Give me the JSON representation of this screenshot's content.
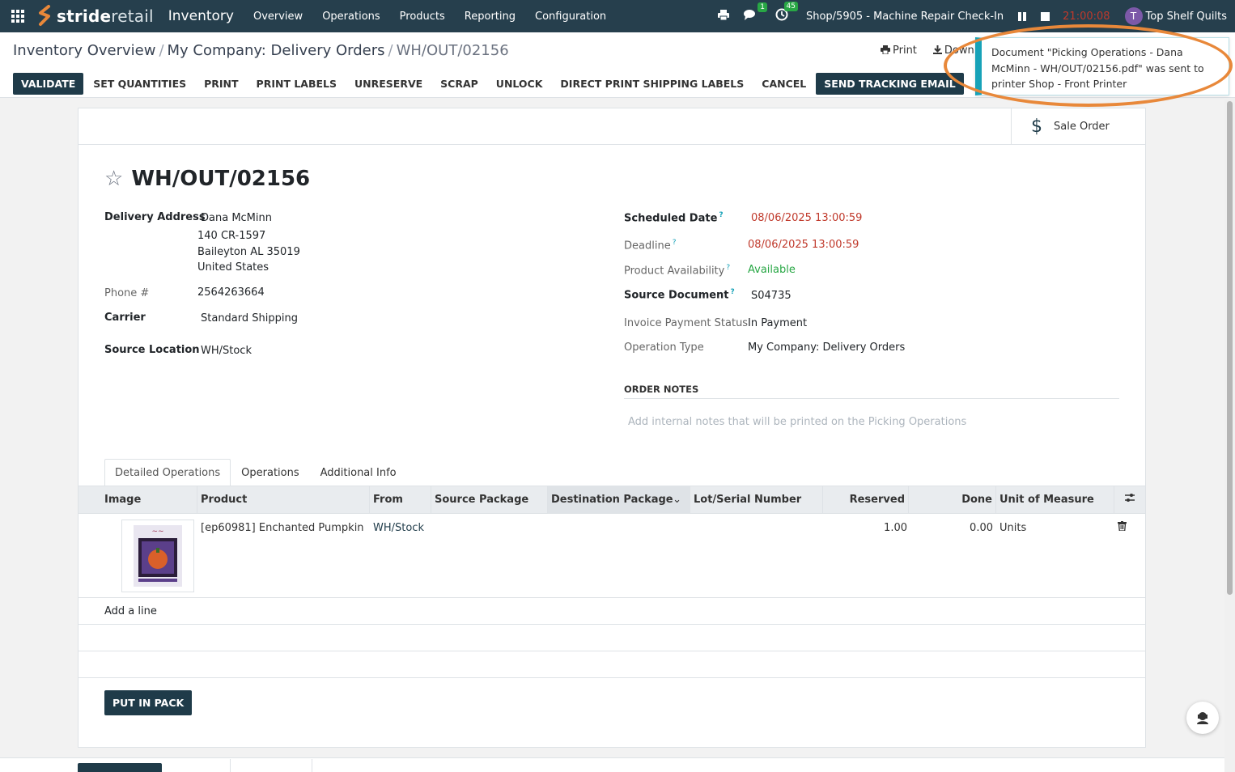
{
  "topbar": {
    "brand_bold": "stride",
    "brand_light": "retail",
    "app_name": "Inventory",
    "nav": [
      "Overview",
      "Operations",
      "Products",
      "Reporting",
      "Configuration"
    ],
    "chat_count": "1",
    "activity_count": "45",
    "shop": "Shop/5905 - Machine Repair Check-In",
    "timer": "21:00:08",
    "avatar_letter": "T",
    "company": "Top Shelf Quilts"
  },
  "breadcrumb": {
    "root": "Inventory Overview",
    "parent": "My Company: Delivery Orders",
    "current": "WH/OUT/02156",
    "sep": "/"
  },
  "control_actions": {
    "print": "Print",
    "download": "Downlo"
  },
  "statusbar": {
    "buttons": [
      "VALIDATE",
      "SET QUANTITIES",
      "PRINT",
      "PRINT LABELS",
      "UNRESERVE",
      "SCRAP",
      "UNLOCK",
      "DIRECT PRINT SHIPPING LABELS",
      "CANCEL",
      "SEND TRACKING EMAIL"
    ]
  },
  "toast": {
    "message": "Document \"Picking Operations - Dana McMinn - WH/OUT/02156.pdf\" was sent to printer Shop - Front Printer"
  },
  "smart_button": {
    "label": "Sale Order"
  },
  "record": {
    "title": "WH/OUT/02156",
    "left": {
      "delivery_address_label": "Delivery Address",
      "address_name": "Dana McMinn",
      "address_line1": "140 CR-1597",
      "address_line2": "Baileyton AL 35019",
      "address_line3": "United States",
      "phone_label": "Phone #",
      "phone": "2564263664",
      "carrier_label": "Carrier",
      "carrier": "Standard Shipping",
      "source_location_label": "Source Location",
      "source_location": "WH/Stock"
    },
    "right": {
      "scheduled_date_label": "Scheduled Date",
      "scheduled_date": "08/06/2025 13:00:59",
      "deadline_label": "Deadline",
      "deadline": "08/06/2025 13:00:59",
      "availability_label": "Product Availability",
      "availability": "Available",
      "source_document_label": "Source Document",
      "source_document": "S04735",
      "payment_status_label": "Invoice Payment Status",
      "payment_status": "In Payment",
      "operation_type_label": "Operation Type",
      "operation_type": "My Company: Delivery Orders"
    },
    "order_notes_title": "ORDER NOTES",
    "order_notes_placeholder": "Add internal notes that will be printed on the Picking Operations",
    "help_mark": "?"
  },
  "tabs": [
    "Detailed Operations",
    "Operations",
    "Additional Info"
  ],
  "table": {
    "columns": [
      "Image",
      "Product",
      "From",
      "Source Package",
      "Destination Package",
      "Lot/Serial Number",
      "Reserved",
      "Done",
      "Unit of Measure"
    ],
    "rows": [
      {
        "product": "[ep60981] Enchanted Pumpkin",
        "from": "WH/Stock",
        "source_package": "",
        "destination_package": "",
        "lot": "",
        "reserved": "1.00",
        "done": "0.00",
        "uom": "Units"
      }
    ],
    "add_line": "Add a line"
  },
  "put_in_pack": "PUT IN PACK",
  "colors": {
    "navbar": "#263f4d",
    "primary": "#1f3b49",
    "toast_accent": "#17a2b8",
    "highlight_ring": "#e8883a",
    "danger": "#c0392b",
    "success": "#28a745"
  }
}
